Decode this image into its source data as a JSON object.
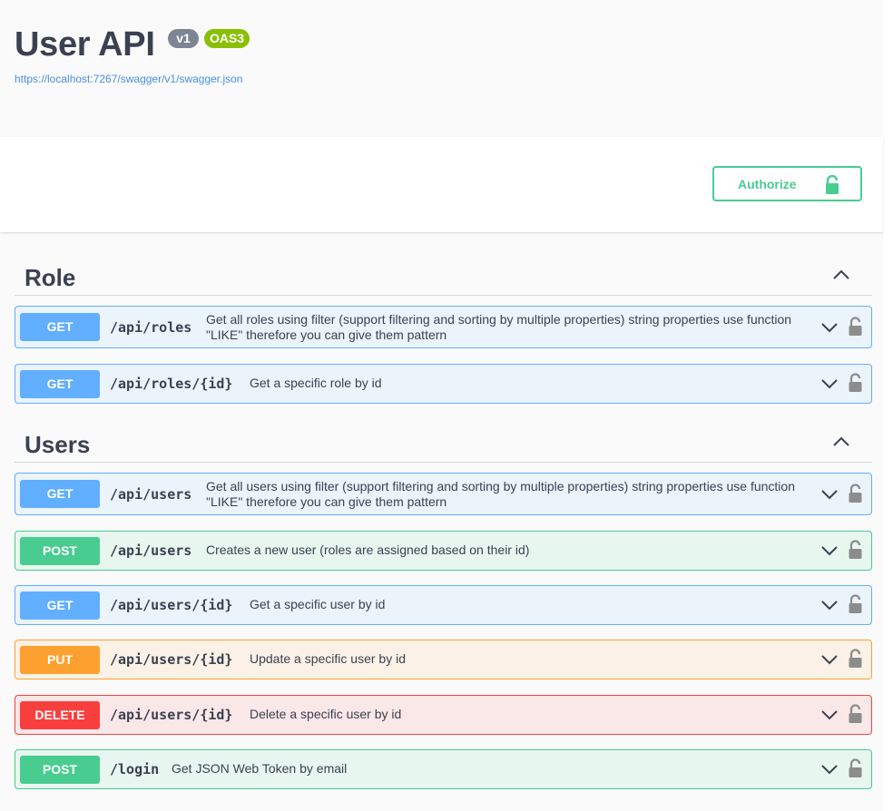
{
  "info": {
    "title": "User API",
    "version_badge": "v1",
    "oas_badge": "OAS3",
    "spec_url": "https://localhost:7267/swagger/v1/swagger.json"
  },
  "scheme": {
    "authorize_label": "Authorize"
  },
  "tags": [
    {
      "name": "Role",
      "operations": [
        {
          "method": "GET",
          "path": "/api/roles",
          "summary": "Get all roles using filter (support filtering and sorting by multiple properties) string properties use function \"LIKE\" therefore you can give them pattern"
        },
        {
          "method": "GET",
          "path": "/api/roles/{id}",
          "summary": "Get a specific role by id"
        }
      ]
    },
    {
      "name": "Users",
      "operations": [
        {
          "method": "GET",
          "path": "/api/users",
          "summary": "Get all users using filter (support filtering and sorting by multiple properties) string properties use function \"LIKE\" therefore you can give them pattern"
        },
        {
          "method": "POST",
          "path": "/api/users",
          "summary": "Creates a new user (roles are assigned based on their id)"
        },
        {
          "method": "GET",
          "path": "/api/users/{id}",
          "summary": "Get a specific user by id"
        },
        {
          "method": "PUT",
          "path": "/api/users/{id}",
          "summary": "Update a specific user by id"
        },
        {
          "method": "DELETE",
          "path": "/api/users/{id}",
          "summary": "Delete a specific user by id"
        },
        {
          "method": "POST",
          "path": "/login",
          "summary": "Get JSON Web Token by email"
        }
      ]
    }
  ],
  "colors": {
    "get": "#61affe",
    "post": "#49cc90",
    "put": "#fca130",
    "delete": "#f93e3e",
    "version_badge": "#7d8492",
    "oas_badge": "#89bf04",
    "link": "#4990e2"
  },
  "icons": {
    "collapse": "chevron-up-icon",
    "expand": "chevron-down-icon",
    "authorize": "unlock-icon",
    "operation_lock": "unlock-icon"
  }
}
